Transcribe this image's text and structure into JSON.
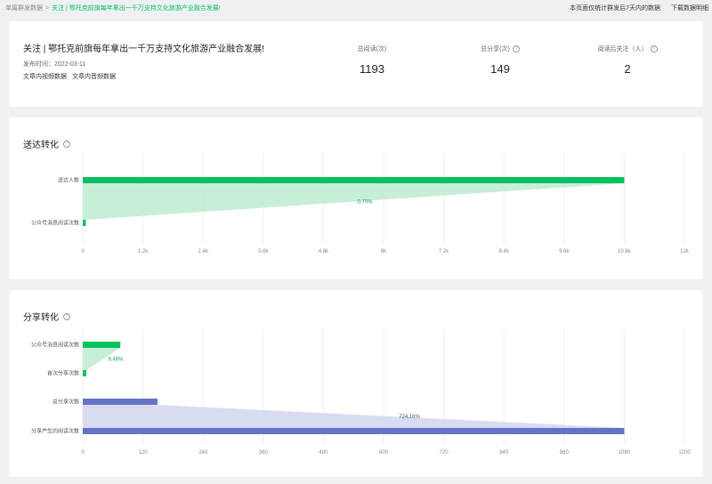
{
  "breadcrumb": {
    "root": "单篇群发数据",
    "current": "关注 | 鄂托克前旗每年拿出一千万支持文化旅游产业融合发展!"
  },
  "header": {
    "note": "本页面仅统计群发后7天内的数据",
    "download": "下载数据明细"
  },
  "article": {
    "title": "关注 | 鄂托克前旗每年拿出一千万支持文化旅游产业融合发展!",
    "date_label": "发布时间：",
    "date": "2022-03-11",
    "link_video": "文章内视频数据",
    "link_audio": "文章内音频数据"
  },
  "stats": [
    {
      "label": "总阅读(次)",
      "value": "1193",
      "has_help": false
    },
    {
      "label": "总分享(次)",
      "value": "149",
      "has_help": true
    },
    {
      "label": "阅读后关注（人）",
      "value": "2",
      "has_help": true
    }
  ],
  "colors": {
    "green": "#07c160",
    "green_light": "#bdebd0",
    "purple": "#6473c7",
    "purple_light": "#d2d6ee"
  },
  "chart_data": [
    {
      "type": "bar",
      "title": "送达转化",
      "orientation": "horizontal",
      "categories": [
        "送达人数",
        "公众号消息阅读次数"
      ],
      "values": [
        10800,
        60
      ],
      "conversion_label": "0.70%",
      "xlim": [
        0,
        12000
      ],
      "xticks": [
        "0",
        "1.2k",
        "2.4k",
        "3.6k",
        "4.8k",
        "6k",
        "7.2k",
        "8.4k",
        "9.6k",
        "10.8k",
        "12k"
      ],
      "color": "#07c160"
    },
    {
      "type": "bar",
      "title": "分享转化",
      "orientation": "horizontal",
      "categories": [
        "公众号消息阅读次数",
        "首次分享次数",
        "总分享次数",
        "分享产生的阅读次数"
      ],
      "values": [
        75,
        7,
        149,
        1080
      ],
      "conversion_labels": [
        "9.46%",
        "724.16%"
      ],
      "xlim": [
        0,
        1200
      ],
      "xticks": [
        "0",
        "120",
        "240",
        "360",
        "480",
        "600",
        "720",
        "840",
        "960",
        "1080",
        "1200"
      ],
      "colors": [
        "#07c160",
        "#07c160",
        "#6473c7",
        "#6473c7"
      ]
    }
  ]
}
